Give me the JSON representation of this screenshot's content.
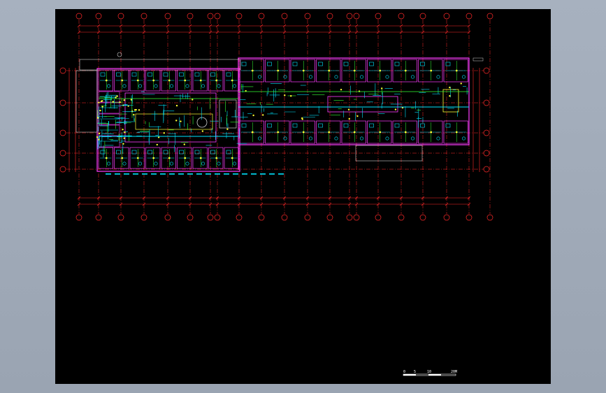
{
  "canvas": {
    "background": "#000000",
    "frame_background": "#a3adbb"
  },
  "colors": {
    "grid": "#ff2a2a",
    "wall": "#ff3dff",
    "fixture": "#00e5ff",
    "pipe": "#33ff33",
    "accent": "#ffff33",
    "outline": "#cfcfcf",
    "text": "#ffffff"
  },
  "scale_bar": {
    "ticks": [
      "0",
      "5",
      "10",
      "20M"
    ]
  },
  "drawing": {
    "column_axes": 21,
    "row_axes": 5,
    "rooms_top_row": 18,
    "rooms_bottom_row": 18
  }
}
